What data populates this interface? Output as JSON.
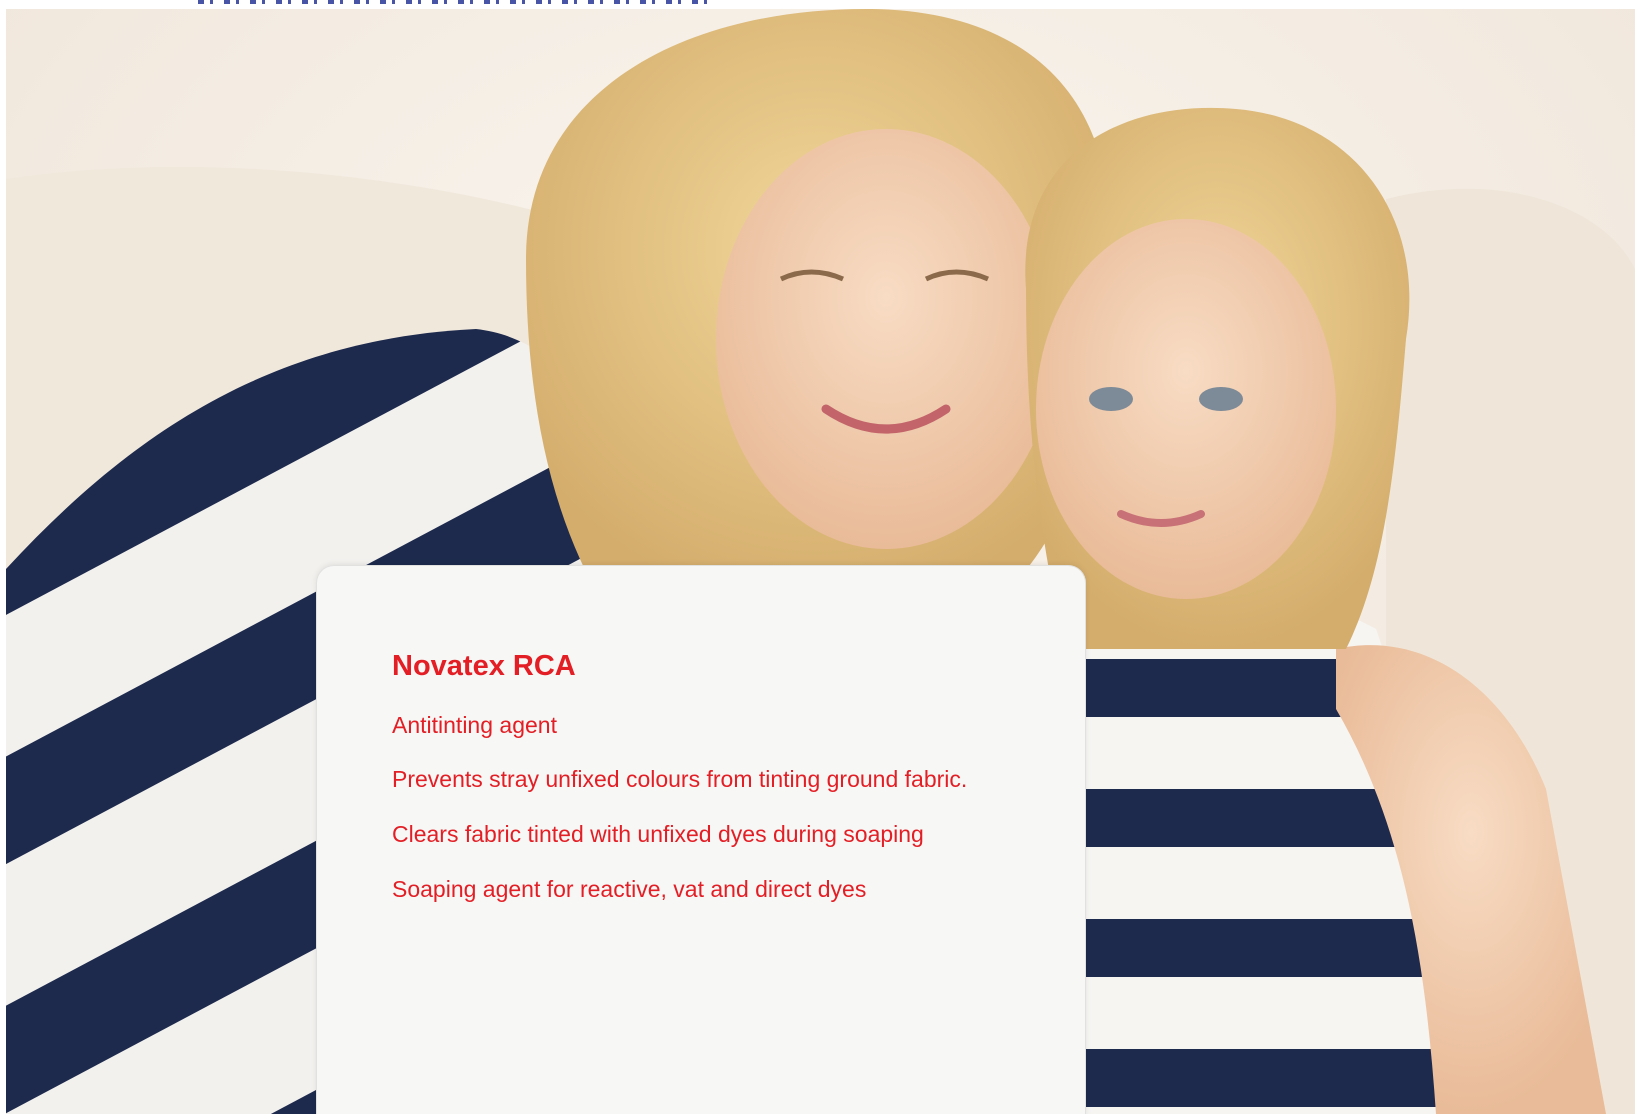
{
  "colors": {
    "heading_red": "#e31e24",
    "stripe_navy": "#1d2a4d",
    "card_white": "#f7f7f6",
    "background_cream": "#f4ede4"
  },
  "photo": {
    "subject": "mother-and-daughter-with-laptop"
  },
  "card": {
    "title": "Novatex RCA",
    "lines": [
      "Antitinting agent",
      "Prevents stray unfixed colours from tinting  ground fabric.",
      "Clears fabric tinted with unfixed dyes during soaping",
      "Soaping agent for reactive, vat and direct dyes"
    ]
  }
}
